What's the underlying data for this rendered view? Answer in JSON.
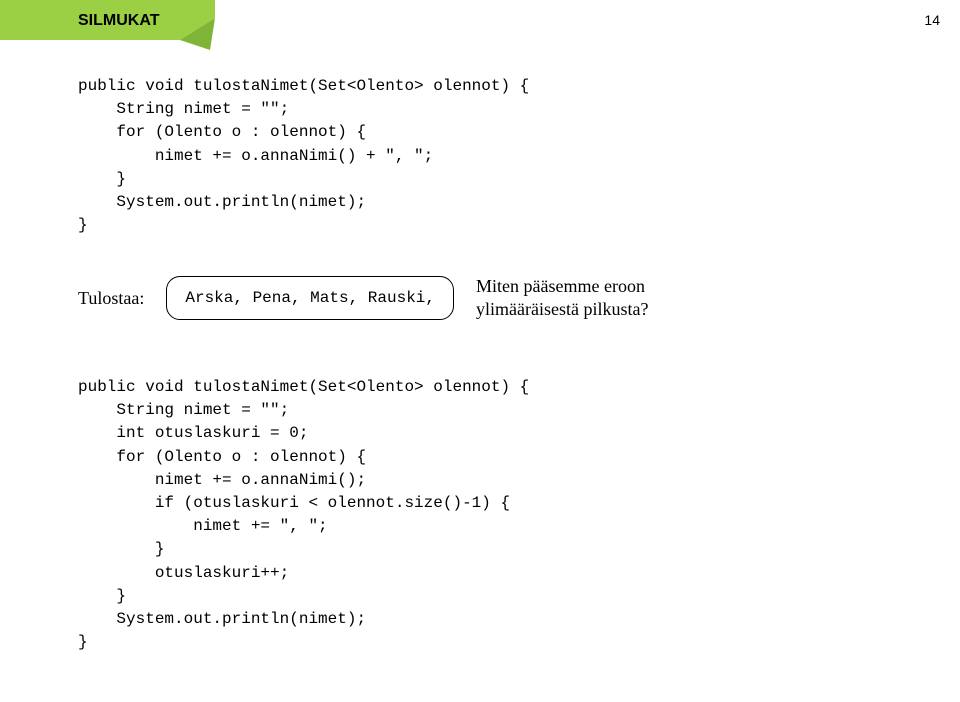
{
  "header": {
    "tab_label": "SILMUKAT",
    "page_number": "14",
    "tab_color_light": "#9bcf44",
    "tab_color_border": "#7fb536",
    "tab_tri_fill": "#7fb536"
  },
  "code1": {
    "l1": "public void tulostaNimet(Set<Olento> olennot) {",
    "l2": "    String nimet = \"\";",
    "l3": "    for (Olento o : olennot) {",
    "l4": "        nimet += o.annaNimi() + \", \";",
    "l5": "    }",
    "l6": "    System.out.println(nimet);",
    "l7": "}"
  },
  "output": {
    "label": "Tulostaa:",
    "text": "Arska, Pena, Mats, Rauski,"
  },
  "question": {
    "line1": "Miten pääsemme eroon",
    "line2": "ylimääräisestä pilkusta?"
  },
  "code2": {
    "l1": "public void tulostaNimet(Set<Olento> olennot) {",
    "l2": "    String nimet = \"\";",
    "l3": "    int otuslaskuri = 0;",
    "l4": "    for (Olento o : olennot) {",
    "l5": "        nimet += o.annaNimi();",
    "l6": "        if (otuslaskuri < olennot.size()-1) {",
    "l7": "            nimet += \", \";",
    "l8": "        }",
    "l9": "        otuslaskuri++;",
    "l10": "    }",
    "l11": "    System.out.println(nimet);",
    "l12": "}"
  }
}
